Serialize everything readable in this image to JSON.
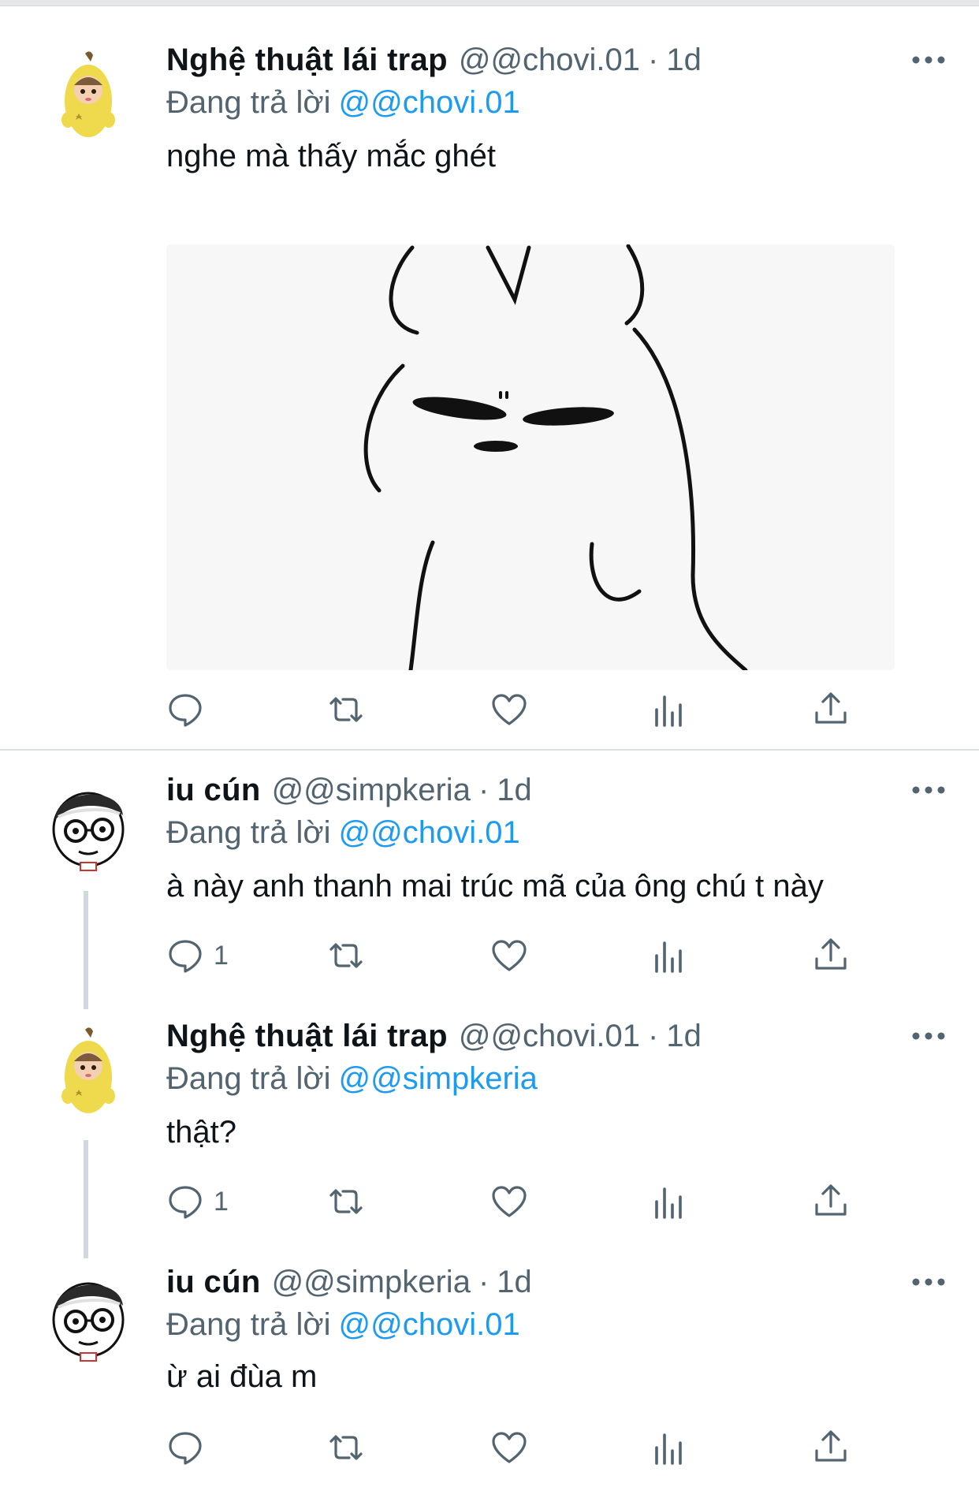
{
  "tweets": [
    {
      "name": "Nghệ thuật lái trap",
      "handle": "@@chovi.01",
      "time": "1d",
      "reply_prefix": "Đang trả lời",
      "reply_to": "@@chovi.01",
      "text": "nghe mà thấy mắc ghét",
      "has_media": true,
      "reply_count": ""
    },
    {
      "name": "iu cún",
      "handle": "@@simpkeria",
      "time": "1d",
      "reply_prefix": "Đang trả lời",
      "reply_to": "@@chovi.01",
      "text": "à này anh thanh mai trúc mã của ông chú t này",
      "reply_count": "1"
    },
    {
      "name": "Nghệ thuật lái trap",
      "handle": "@@chovi.01",
      "time": "1d",
      "reply_prefix": "Đang trả lời",
      "reply_to": "@@simpkeria",
      "text": "thật?",
      "reply_count": "1"
    },
    {
      "name": "iu cún",
      "handle": "@@simpkeria",
      "time": "1d",
      "reply_prefix": "Đang trả lời",
      "reply_to": "@@chovi.01",
      "text": "ừ ai đùa m",
      "reply_count": ""
    }
  ],
  "icons": {
    "reply": "reply-icon",
    "retweet": "retweet-icon",
    "like": "heart-icon",
    "views": "views-icon",
    "share": "share-icon",
    "more": "more-icon"
  },
  "colors": {
    "link": "#1d9bf0",
    "secondary": "#536471",
    "divider": "#dde0e3"
  }
}
